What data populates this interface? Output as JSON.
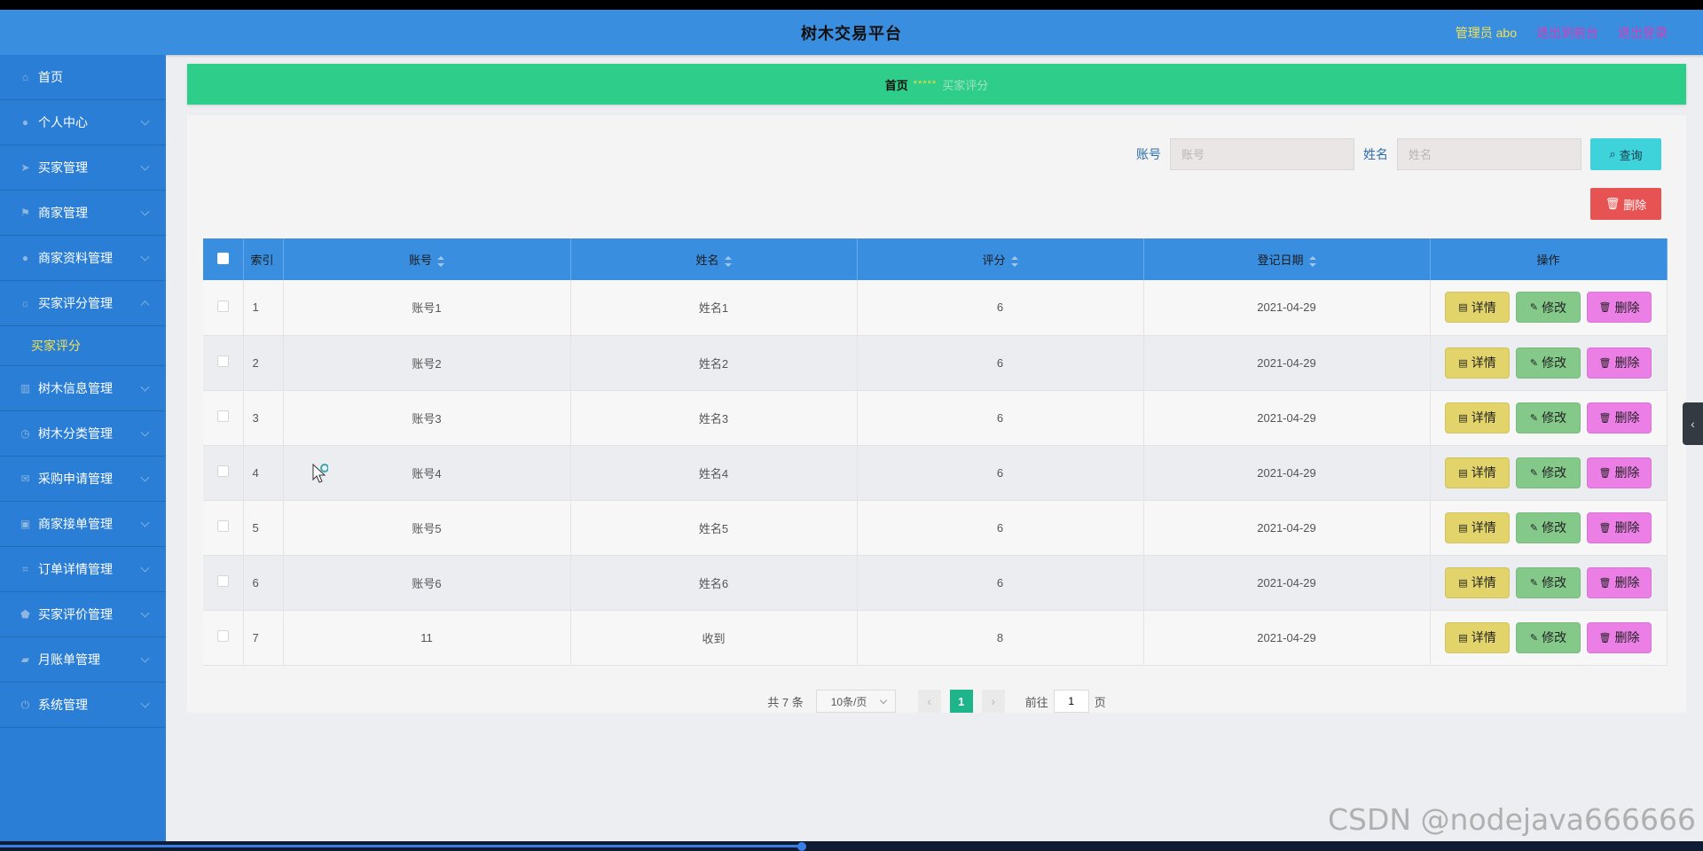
{
  "header": {
    "title": "树木交易平台",
    "admin": "管理员 abo",
    "back_front": "退出到前台",
    "logout": "退出登录"
  },
  "sidebar": {
    "items": [
      {
        "label": "首页",
        "icon": "home-icon",
        "glyph": "⌂"
      },
      {
        "label": "个人中心",
        "icon": "user-icon",
        "glyph": "●"
      },
      {
        "label": "买家管理",
        "icon": "send-icon",
        "glyph": "➤"
      },
      {
        "label": "商家管理",
        "icon": "flag-icon",
        "glyph": "⚑"
      },
      {
        "label": "商家资料管理",
        "icon": "user-icon",
        "glyph": "●"
      },
      {
        "label": "买家评分管理",
        "icon": "bell-icon",
        "glyph": "☼",
        "expanded": true
      },
      {
        "label": "树木信息管理",
        "icon": "chart-icon",
        "glyph": "▥"
      },
      {
        "label": "树木分类管理",
        "icon": "clock-icon",
        "glyph": "◷"
      },
      {
        "label": "采购申请管理",
        "icon": "mail-icon",
        "glyph": "✉"
      },
      {
        "label": "商家接单管理",
        "icon": "bag-icon",
        "glyph": "▣"
      },
      {
        "label": "订单详情管理",
        "icon": "crop-icon",
        "glyph": "⌗"
      },
      {
        "label": "买家评价管理",
        "icon": "shield-icon",
        "glyph": "⬟"
      },
      {
        "label": "月账单管理",
        "icon": "like-icon",
        "glyph": "▰"
      },
      {
        "label": "系统管理",
        "icon": "power-icon",
        "glyph": "⏻"
      }
    ],
    "submenu": "买家评分"
  },
  "breadcrumb": {
    "home": "首页",
    "separator": "*****",
    "current": "买家评分"
  },
  "search": {
    "account_label": "账号",
    "account_placeholder": "账号",
    "name_label": "姓名",
    "name_placeholder": "姓名",
    "query_button": "查询"
  },
  "delete_button": "删除",
  "table": {
    "headers": {
      "index": "索引",
      "account": "账号",
      "name": "姓名",
      "score": "评分",
      "date": "登记日期",
      "ops": "操作"
    },
    "rows": [
      {
        "index": "1",
        "account": "账号1",
        "name": "姓名1",
        "score": "6",
        "date": "2021-04-29"
      },
      {
        "index": "2",
        "account": "账号2",
        "name": "姓名2",
        "score": "6",
        "date": "2021-04-29"
      },
      {
        "index": "3",
        "account": "账号3",
        "name": "姓名3",
        "score": "6",
        "date": "2021-04-29"
      },
      {
        "index": "4",
        "account": "账号4",
        "name": "姓名4",
        "score": "6",
        "date": "2021-04-29"
      },
      {
        "index": "5",
        "account": "账号5",
        "name": "姓名5",
        "score": "6",
        "date": "2021-04-29"
      },
      {
        "index": "6",
        "account": "账号6",
        "name": "姓名6",
        "score": "6",
        "date": "2021-04-29"
      },
      {
        "index": "7",
        "account": "11",
        "name": "收到",
        "score": "8",
        "date": "2021-04-29"
      }
    ],
    "ops": {
      "detail": "详情",
      "edit": "修改",
      "delete": "删除"
    }
  },
  "pagination": {
    "total": "共 7 条",
    "page_size": "10条/页",
    "current_page": "1",
    "goto_label": "前往",
    "goto_value": "1",
    "page_suffix": "页"
  },
  "watermark": "CSDN @nodejava666666",
  "colors": {
    "header": "#3a8ee0",
    "sidebar": "#2a7ed6",
    "breadcrumb": "#2ecd8a",
    "detail": "#e2d46a",
    "edit": "#85c98a",
    "delete": "#ec7fe6",
    "top_delete": "#e75252",
    "query": "#3ed2da"
  }
}
